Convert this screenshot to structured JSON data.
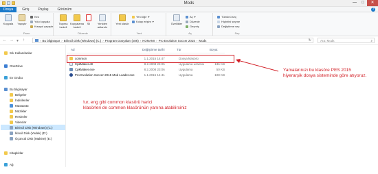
{
  "window": {
    "title": "Mods",
    "controls": [
      "—",
      "□",
      "✕"
    ]
  },
  "tabs": [
    "Dosya",
    "Giriş",
    "Paylaş",
    "Görünüm"
  ],
  "ribbon": {
    "pano": {
      "label": "Pano",
      "kopyala": "Kopyala",
      "yapistir": "Yapıştır",
      "kes": "Kes",
      "yolu_kopyala": "Yolu kopyala",
      "kisayol_yapistir": "Kısayol yapıştır"
    },
    "duzenle": {
      "label": "Düzenle",
      "tasima": "Taşıma hedefi",
      "kopyalama": "Kopyalama hedefi",
      "sil": "Sil",
      "yeniden": "Yeniden adlandır"
    },
    "yeni": {
      "label": "Yeni",
      "yeni_klasor": "Yeni klasör",
      "yeni_oge": "Yeni öğe",
      "kolay_erisim": "Kolay erişim"
    },
    "ac": {
      "label": "Aç",
      "ozellikler": "Özellikler",
      "ac": "Aç",
      "duzenle": "Düzenle",
      "gecmis": "Geçmiş"
    },
    "sec": {
      "label": "Seç",
      "tumunu": "Tümünü seç",
      "hicbirini": "Hiçbirini seçme",
      "degistir": "Değiştirme seç"
    }
  },
  "address": {
    "crumbs": [
      "Bu bilgisayar",
      "Birincil Disk (Windows) (C:)",
      "Program Dosyaları (x86)",
      "KONAMI",
      "Pro Evolution Soccer 2015",
      "Mods"
    ],
    "search_placeholder": "Ara: Mods"
  },
  "nav": {
    "items": [
      {
        "label": "Sık Kullanılanlar",
        "icon": "star-icon"
      },
      {
        "label": "OneDrive",
        "icon": "cloud-icon"
      },
      {
        "label": "Ev Grubu",
        "icon": "homegroup-icon"
      },
      {
        "label": "Bu bilgisayar",
        "icon": "computer-icon"
      },
      {
        "label": "Belgeler",
        "icon": "folder-icon"
      },
      {
        "label": "İndirilenler",
        "icon": "folder-icon"
      },
      {
        "label": "Masaüstü",
        "icon": "folder-icon"
      },
      {
        "label": "Müzikler",
        "icon": "folder-icon"
      },
      {
        "label": "Resimler",
        "icon": "folder-icon"
      },
      {
        "label": "Videolar",
        "icon": "folder-icon"
      },
      {
        "label": "Birincil Disk (Windows) (C:)",
        "icon": "drive-icon"
      },
      {
        "label": "İkincil Disk (Yedek) (D:)",
        "icon": "drive-icon"
      },
      {
        "label": "Üçüncül Disk (Makine) (E:)",
        "icon": "drive-icon"
      },
      {
        "label": "Kitaplıklar",
        "icon": "library-icon"
      },
      {
        "label": "Ağ",
        "icon": "network-icon"
      }
    ]
  },
  "files": {
    "headers": {
      "name": "Ad",
      "date": "Değiştirme tarihi",
      "type": "Tür",
      "size": "Boyut"
    },
    "rows": [
      {
        "name": "common",
        "date": "1.1.2015 14:47",
        "type": "Dosya klasörü",
        "size": "",
        "icon": "folder-icon"
      },
      {
        "name": "CpkMaker.dll",
        "date": "8.2.2008 23:05",
        "type": "Uygulama uzantısı",
        "size": "136 KB",
        "icon": "dll-icon"
      },
      {
        "name": "CpkMaker.exe",
        "date": "8.2.2008 23:06",
        "type": "Uygulama",
        "size": "50 KB",
        "icon": "exe-icon"
      },
      {
        "name": "Pro Evolution Soccer 2015 Mod Loader.exe",
        "date": "1.1.2015 14:41",
        "type": "Uygulama",
        "size": "108 KB",
        "icon": "pes-exe-icon"
      }
    ]
  },
  "annotations": {
    "right": [
      "Yamalarınızı bu klasöre PES 2015",
      "hiyerarşik dosya sisteminde göre atıyoruz."
    ],
    "left": [
      "!ur, eng gibi common klasörü harici",
      "klasörleri de common klasörünün yanına atabilirsiniz"
    ]
  },
  "colors": {
    "accent": "#1979ca",
    "annotation_red": "#d21f26",
    "selection": "#cce8ff",
    "folder_yellow": "#f2c94c"
  }
}
